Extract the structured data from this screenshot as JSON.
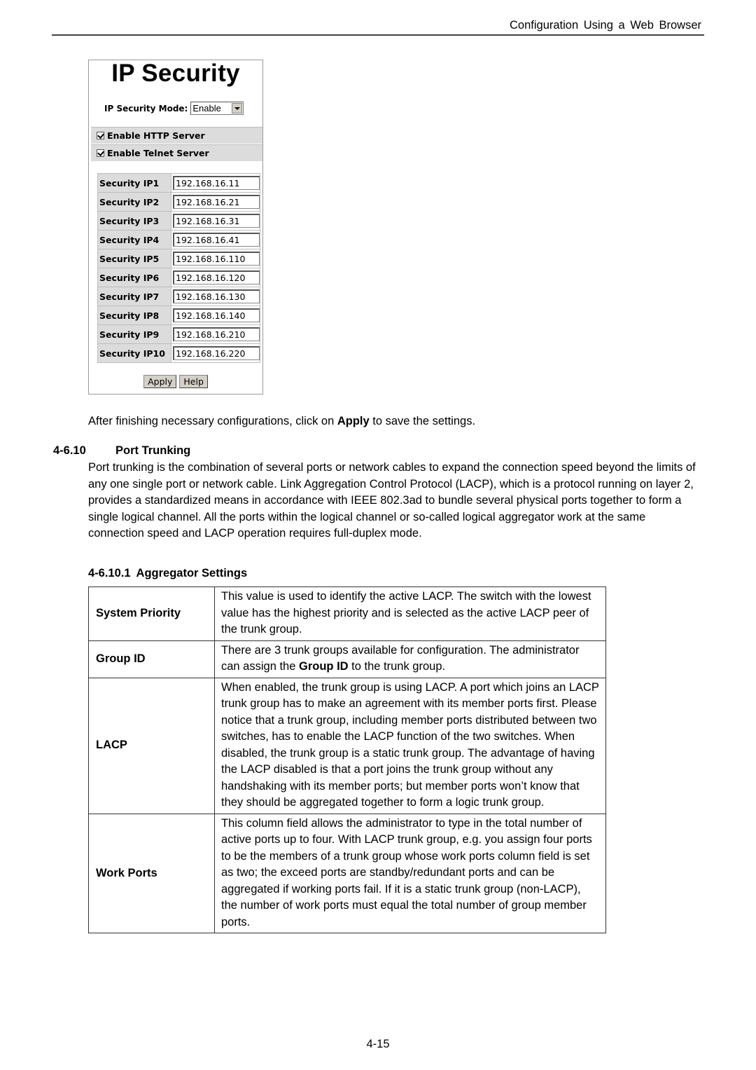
{
  "header": {
    "running_title": "Configuration Using a Web Browser"
  },
  "ip_security_panel": {
    "title": "IP Security",
    "mode_label": "IP Security Mode:",
    "mode_value": "Enable",
    "checkboxes": [
      {
        "label": "Enable HTTP Server",
        "checked": true
      },
      {
        "label": "Enable Telnet Server",
        "checked": true
      }
    ],
    "security_ips": [
      {
        "label": "Security IP1",
        "value": "192.168.16.11"
      },
      {
        "label": "Security IP2",
        "value": "192.168.16.21"
      },
      {
        "label": "Security IP3",
        "value": "192.168.16.31"
      },
      {
        "label": "Security IP4",
        "value": "192.168.16.41"
      },
      {
        "label": "Security IP5",
        "value": "192.168.16.110"
      },
      {
        "label": "Security IP6",
        "value": "192.168.16.120"
      },
      {
        "label": "Security IP7",
        "value": "192.168.16.130"
      },
      {
        "label": "Security IP8",
        "value": "192.168.16.140"
      },
      {
        "label": "Security IP9",
        "value": "192.168.16.210"
      },
      {
        "label": "Security IP10",
        "value": "192.168.16.220"
      }
    ],
    "buttons": {
      "apply": "Apply",
      "help": "Help"
    }
  },
  "after_text": {
    "before": "After finishing necessary configurations, click on ",
    "bold": "Apply",
    "after": " to save the settings."
  },
  "section": {
    "number": "4-6.10",
    "title": "Port Trunking",
    "body": "Port trunking is the combination of several ports or network cables to expand the connection speed beyond the limits of any one single port or network cable. Link Aggregation Control Protocol (LACP), which is a protocol running on layer 2, provides a standardized means in accordance with IEEE 802.3ad to bundle several physical ports together to form a single logical channel. All the ports within the logical channel or so-called logical aggregator work at the same connection speed and LACP operation requires full-duplex mode."
  },
  "subsection": {
    "number": "4-6.10.1",
    "title": "Aggregator Settings",
    "rows": [
      {
        "term": "System Priority",
        "desc": "This value is used to identify the active LACP. The switch with the lowest value has the highest priority and is selected as the active LACP peer of the trunk group."
      },
      {
        "term": "Group ID",
        "desc_before": "There are 3 trunk groups available for configuration. The administrator can assign the ",
        "desc_bold": "Group ID",
        "desc_after": " to the trunk group."
      },
      {
        "term": "LACP",
        "desc": "When enabled, the trunk group is using LACP. A port which joins an LACP trunk group has to make an agreement with its member ports first. Please notice that a trunk group, including member ports distributed between two switches, has to enable the LACP function of the two switches. When disabled, the trunk group is a static trunk group. The advantage of having the LACP disabled is that a port joins the trunk group without any handshaking with its member ports; but member ports won’t know that they should be aggregated together to form a logic trunk group."
      },
      {
        "term": "Work Ports",
        "desc": "This column field allows the administrator to type in the total number of active ports up to four. With LACP trunk group, e.g. you assign four ports to be the members of a trunk group whose work ports column field is set as two; the exceed ports are standby/redundant ports and can be aggregated if working ports fail. If it is a static trunk group (non-LACP), the number of work ports must equal the total number of group member ports."
      }
    ]
  },
  "footer": {
    "page_number": "4-15"
  }
}
